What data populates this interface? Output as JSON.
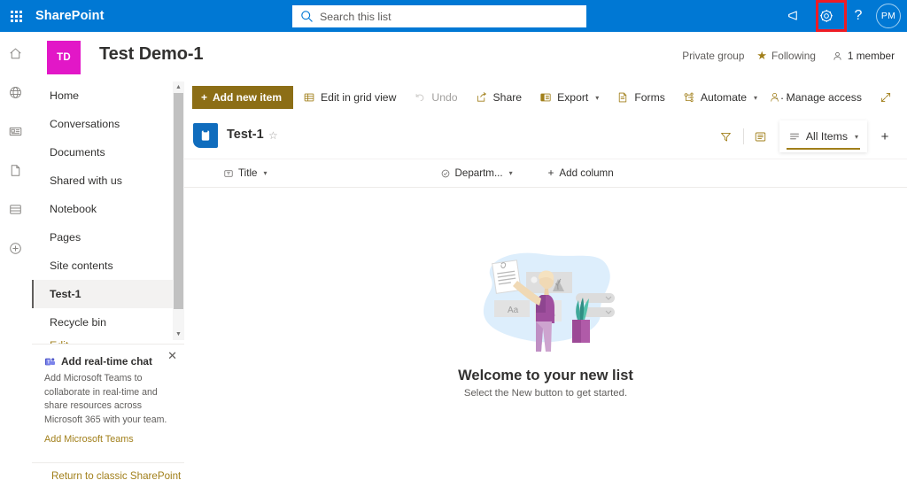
{
  "suite": {
    "waffle_label": "app-launcher",
    "brand": "SharePoint",
    "search_placeholder": "Search this list",
    "search_value": "",
    "megaphone_title": "What's new",
    "settings_title": "Settings",
    "help_label": "?",
    "avatar_initials": "PM",
    "brand_color": "#0078d4",
    "highlight_color": "#ee1b24"
  },
  "rail": {
    "items": [
      {
        "name": "home-icon",
        "label": "Home"
      },
      {
        "name": "globe-icon",
        "label": "Sites"
      },
      {
        "name": "news-icon",
        "label": "News"
      },
      {
        "name": "file-icon",
        "label": "Files"
      },
      {
        "name": "lists-icon",
        "label": "Lists"
      },
      {
        "name": "create-icon",
        "label": "Create"
      }
    ]
  },
  "site": {
    "logo_initials": "TD",
    "logo_color": "#e217c7",
    "title": "Test Demo-1",
    "privacy": "Private group",
    "following": "Following",
    "members": "1 member"
  },
  "sidebar": {
    "items": [
      {
        "label": "Home",
        "active": false
      },
      {
        "label": "Conversations",
        "active": false
      },
      {
        "label": "Documents",
        "active": false
      },
      {
        "label": "Shared with us",
        "active": false
      },
      {
        "label": "Notebook",
        "active": false
      },
      {
        "label": "Pages",
        "active": false
      },
      {
        "label": "Site contents",
        "active": false
      },
      {
        "label": "Test-1",
        "active": true
      },
      {
        "label": "Recycle bin",
        "active": false
      }
    ],
    "edit_label": "Edit",
    "promo": {
      "title": "Add real-time chat",
      "body": "Add Microsoft Teams to collaborate in real-time and share resources across Microsoft 365 with your team.",
      "link": "Add Microsoft Teams",
      "close": "✕"
    },
    "classic_link": "Return to classic SharePoint"
  },
  "commandbar": {
    "new_item": "Add new item",
    "items": [
      {
        "label": "Edit in grid view",
        "icon": "grid-icon",
        "disabled": false,
        "caret": false
      },
      {
        "label": "Undo",
        "icon": "undo-icon",
        "disabled": true,
        "caret": false
      },
      {
        "label": "Share",
        "icon": "share-icon",
        "disabled": false,
        "caret": false
      },
      {
        "label": "Export",
        "icon": "export-icon",
        "disabled": false,
        "caret": true
      },
      {
        "label": "Forms",
        "icon": "forms-icon",
        "disabled": false,
        "caret": false
      },
      {
        "label": "Automate",
        "icon": "automate-icon",
        "disabled": false,
        "caret": true
      }
    ],
    "overflow": "···",
    "manage_access": "Manage access",
    "expand_title": "Full screen",
    "accent_color": "#a17f1a",
    "primary_bg": "#8c6e16"
  },
  "list": {
    "name": "Test-1",
    "favorite_icon": "☆",
    "filter_title": "Filter",
    "details_title": "List details",
    "view_name": "All Items",
    "add_view": "+",
    "columns": [
      {
        "label": "Title",
        "icon": "text-column-icon"
      },
      {
        "label": "Departm...",
        "icon": "choice-column-icon"
      }
    ],
    "add_column": "Add column",
    "empty_title": "Welcome to your new list",
    "empty_subtitle": "Select the New button to get started."
  }
}
